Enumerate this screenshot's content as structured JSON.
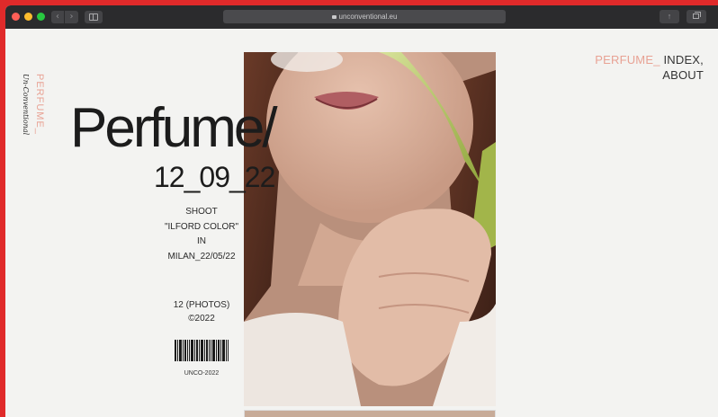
{
  "browser": {
    "url": "unconventional.eu",
    "back_label": "‹",
    "forward_label": "›",
    "share_label": "↑"
  },
  "logo": {
    "brand": "PERFUME_",
    "signature": "Un-Conventional"
  },
  "nav": {
    "items": [
      "PERFUME_",
      "INDEX,",
      "ABOUT"
    ]
  },
  "hero": {
    "title": "Perfume/",
    "date": "12_09_22"
  },
  "info": {
    "line1": "SHOOT",
    "line2": "\"ILFORD COLOR\"",
    "line3": "IN",
    "line4": "MILAN_22/05/22"
  },
  "count": {
    "photos": "12 (PHOTOS)",
    "year": "©2022"
  },
  "barcode": {
    "label": "UNCO-2022"
  },
  "colors": {
    "accent": "#e8a294",
    "frame": "#e02a2a",
    "page": "#f3f3f1"
  }
}
